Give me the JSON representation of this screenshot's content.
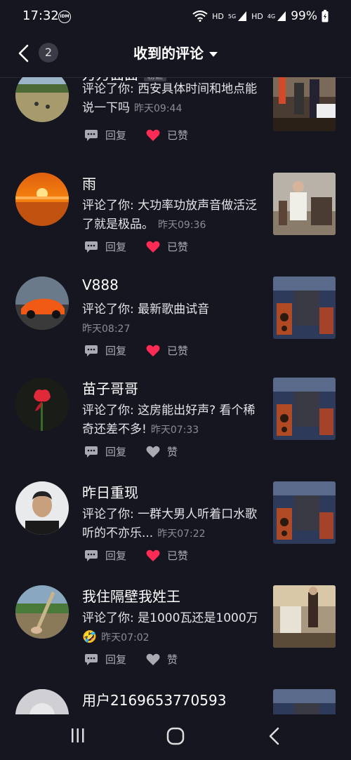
{
  "status": {
    "time": "17:32",
    "idm": "IDM",
    "hd1": "HD",
    "sig1": "5G",
    "hd2": "HD",
    "sig2": "4G",
    "battery": "99%"
  },
  "header": {
    "count": "2",
    "title": "收到的评论"
  },
  "comments": [
    {
      "name": "万万面面",
      "badge": "粉丝",
      "text": "评论了你: 西安具体时间和地点能说一下吗",
      "time": "昨天09:44",
      "reply": "回复",
      "like": "已赞",
      "liked": true
    },
    {
      "name": "雨",
      "text": "评论了你: 大功率功放声音做活泛了就是极品。",
      "time": "昨天09:36",
      "reply": "回复",
      "like": "已赞",
      "liked": true
    },
    {
      "name": "V888",
      "text": "评论了你: 最新歌曲试音",
      "time": "昨天08:27",
      "reply": "回复",
      "like": "已赞",
      "liked": true
    },
    {
      "name": "苗子哥哥",
      "text": "评论了你: 这房能出好声? 看个稀奇还差不多!",
      "time": "昨天07:33",
      "reply": "回复",
      "like": "赞",
      "liked": false
    },
    {
      "name": "昨日重现",
      "text": "评论了你: 一群大男人听着口水歌  听的不亦乐...",
      "time": "昨天07:22",
      "reply": "回复",
      "like": "已赞",
      "liked": true
    },
    {
      "name": "我住隔壁我姓王",
      "text": "评论了你: 是1000瓦还是1000万🤣",
      "time": "昨天07:02",
      "reply": "回复",
      "like": "赞",
      "liked": false
    },
    {
      "name": "用户2169653770593",
      "text": "",
      "time": "",
      "reply": "",
      "like": "",
      "liked": false
    }
  ],
  "colors": {
    "bg": "#15161f",
    "liked": "#fe2c55",
    "muted": "#a9aab2"
  }
}
